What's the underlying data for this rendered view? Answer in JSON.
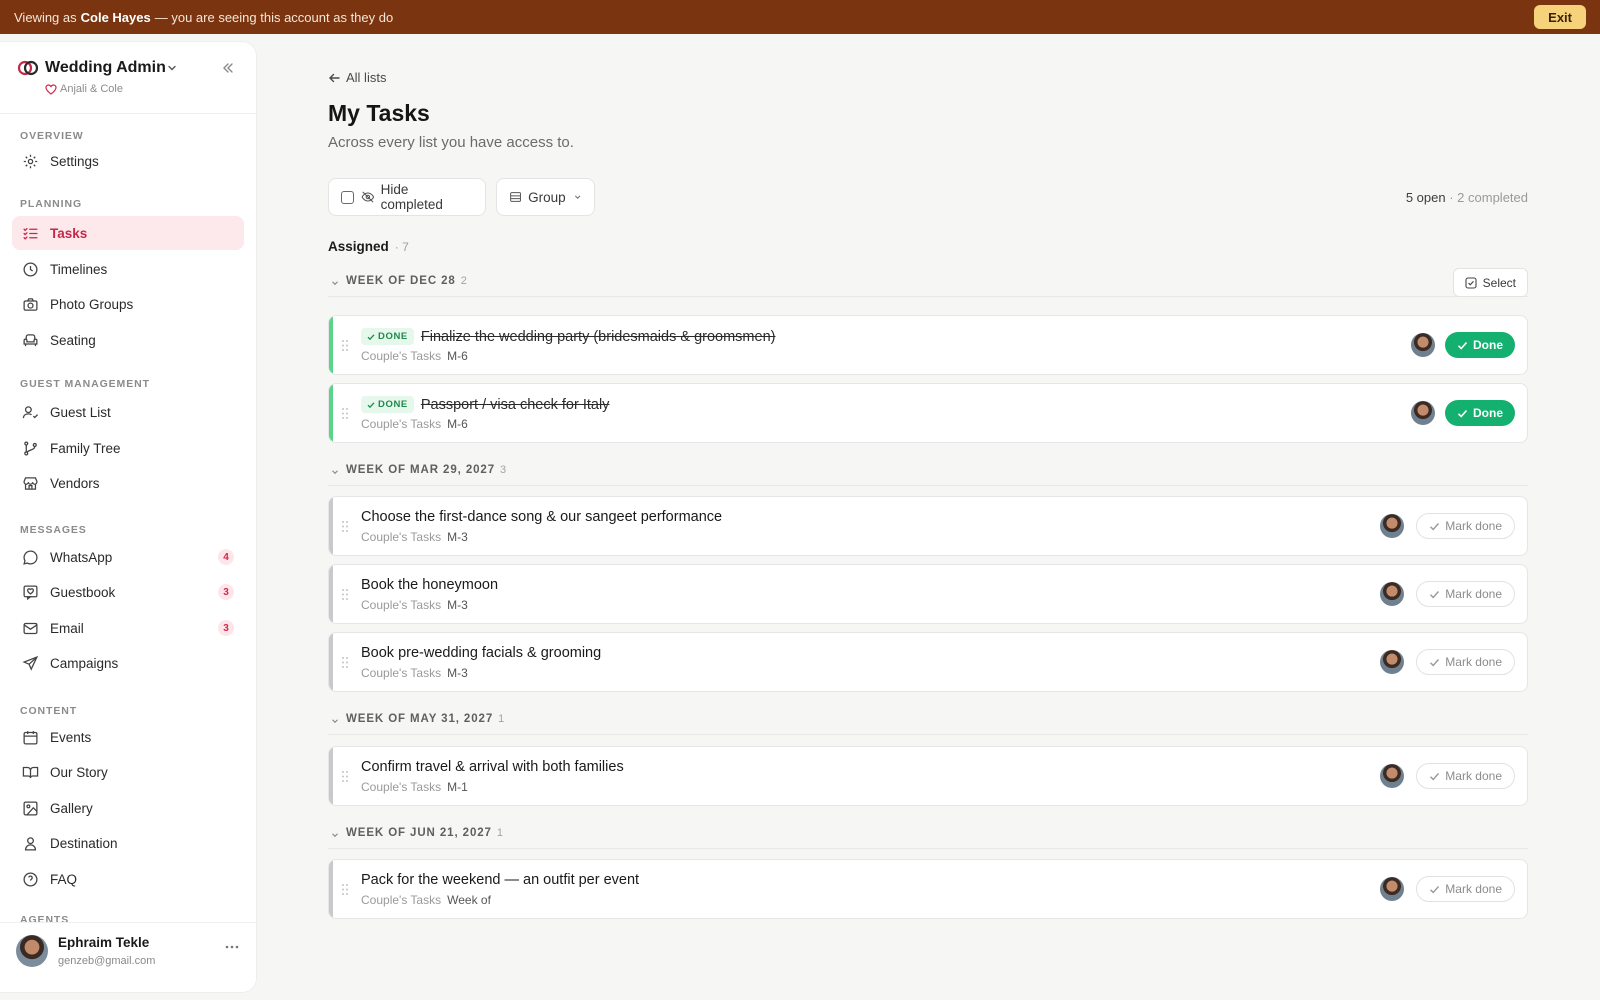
{
  "banner": {
    "prefix": "Viewing as",
    "name": "Cole Hayes",
    "suffix": "— you are seeing this account as they do",
    "exit_label": "Exit"
  },
  "sidebar": {
    "brand": "Wedding Admin",
    "couple": "Anjali & Cole",
    "sections": [
      {
        "label": "OVERVIEW",
        "items": [
          {
            "label": "Settings",
            "icon": "gear-icon"
          }
        ]
      },
      {
        "label": "PLANNING",
        "items": [
          {
            "label": "Tasks",
            "icon": "checklist-icon",
            "active": true
          },
          {
            "label": "Timelines",
            "icon": "clock-icon"
          },
          {
            "label": "Photo Groups",
            "icon": "camera-icon"
          },
          {
            "label": "Seating",
            "icon": "armchair-icon"
          }
        ]
      },
      {
        "label": "GUEST MANAGEMENT",
        "items": [
          {
            "label": "Guest List",
            "icon": "user-check-icon"
          },
          {
            "label": "Family Tree",
            "icon": "branch-icon"
          },
          {
            "label": "Vendors",
            "icon": "store-icon"
          }
        ]
      },
      {
        "label": "MESSAGES",
        "items": [
          {
            "label": "WhatsApp",
            "icon": "chat-bubble-icon",
            "badge": "4"
          },
          {
            "label": "Guestbook",
            "icon": "heart-message-icon",
            "badge": "3"
          },
          {
            "label": "Email",
            "icon": "mail-icon",
            "badge": "3"
          },
          {
            "label": "Campaigns",
            "icon": "send-icon"
          }
        ]
      },
      {
        "label": "CONTENT",
        "items": [
          {
            "label": "Events",
            "icon": "calendar-icon"
          },
          {
            "label": "Our Story",
            "icon": "book-open-icon"
          },
          {
            "label": "Gallery",
            "icon": "image-icon"
          },
          {
            "label": "Destination",
            "icon": "map-pin-user-icon"
          },
          {
            "label": "FAQ",
            "icon": "help-circle-icon"
          }
        ]
      },
      {
        "label": "AGENTS",
        "items": []
      }
    ],
    "user": {
      "name": "Ephraim Tekle",
      "email": "genzeb@gmail.com"
    }
  },
  "main": {
    "back_label": "All lists",
    "title": "My Tasks",
    "subtitle": "Across every list you have access to.",
    "hide_completed_label": "Hide completed",
    "group_label": "Group",
    "open_count": "5 open",
    "completed_count": "· 2 completed",
    "assigned_label": "Assigned",
    "assigned_count": "· 7",
    "select_label": "Select",
    "done_pill": "DONE",
    "done_button": "Done",
    "mark_done_button": "Mark done",
    "weeks": [
      {
        "label": "WEEK OF DEC 28",
        "count": "2",
        "tasks": [
          {
            "title": "Finalize the wedding party (bridesmaids & groomsmen)",
            "list": "Couple's Tasks",
            "code": "M-6",
            "done": true
          },
          {
            "title": "Passport / visa check for Italy",
            "list": "Couple's Tasks",
            "code": "M-6",
            "done": true
          }
        ]
      },
      {
        "label": "WEEK OF MAR 29, 2027",
        "count": "3",
        "tasks": [
          {
            "title": "Choose the first-dance song & our sangeet performance",
            "list": "Couple's Tasks",
            "code": "M-3",
            "done": false
          },
          {
            "title": "Book the honeymoon",
            "list": "Couple's Tasks",
            "code": "M-3",
            "done": false
          },
          {
            "title": "Book pre-wedding facials & grooming",
            "list": "Couple's Tasks",
            "code": "M-3",
            "done": false
          }
        ]
      },
      {
        "label": "WEEK OF MAY 31, 2027",
        "count": "1",
        "tasks": [
          {
            "title": "Confirm travel & arrival with both families",
            "list": "Couple's Tasks",
            "code": "M-1",
            "done": false
          }
        ]
      },
      {
        "label": "WEEK OF JUN 21, 2027",
        "count": "1",
        "tasks": [
          {
            "title": "Pack for the weekend — an outfit per event",
            "list": "Couple's Tasks",
            "code": "Week of",
            "done": false
          }
        ]
      }
    ]
  },
  "colors": {
    "banner": "#7a3510",
    "accent": "#c4294a",
    "done_green": "#14b070",
    "exit": "#f6d27a"
  }
}
